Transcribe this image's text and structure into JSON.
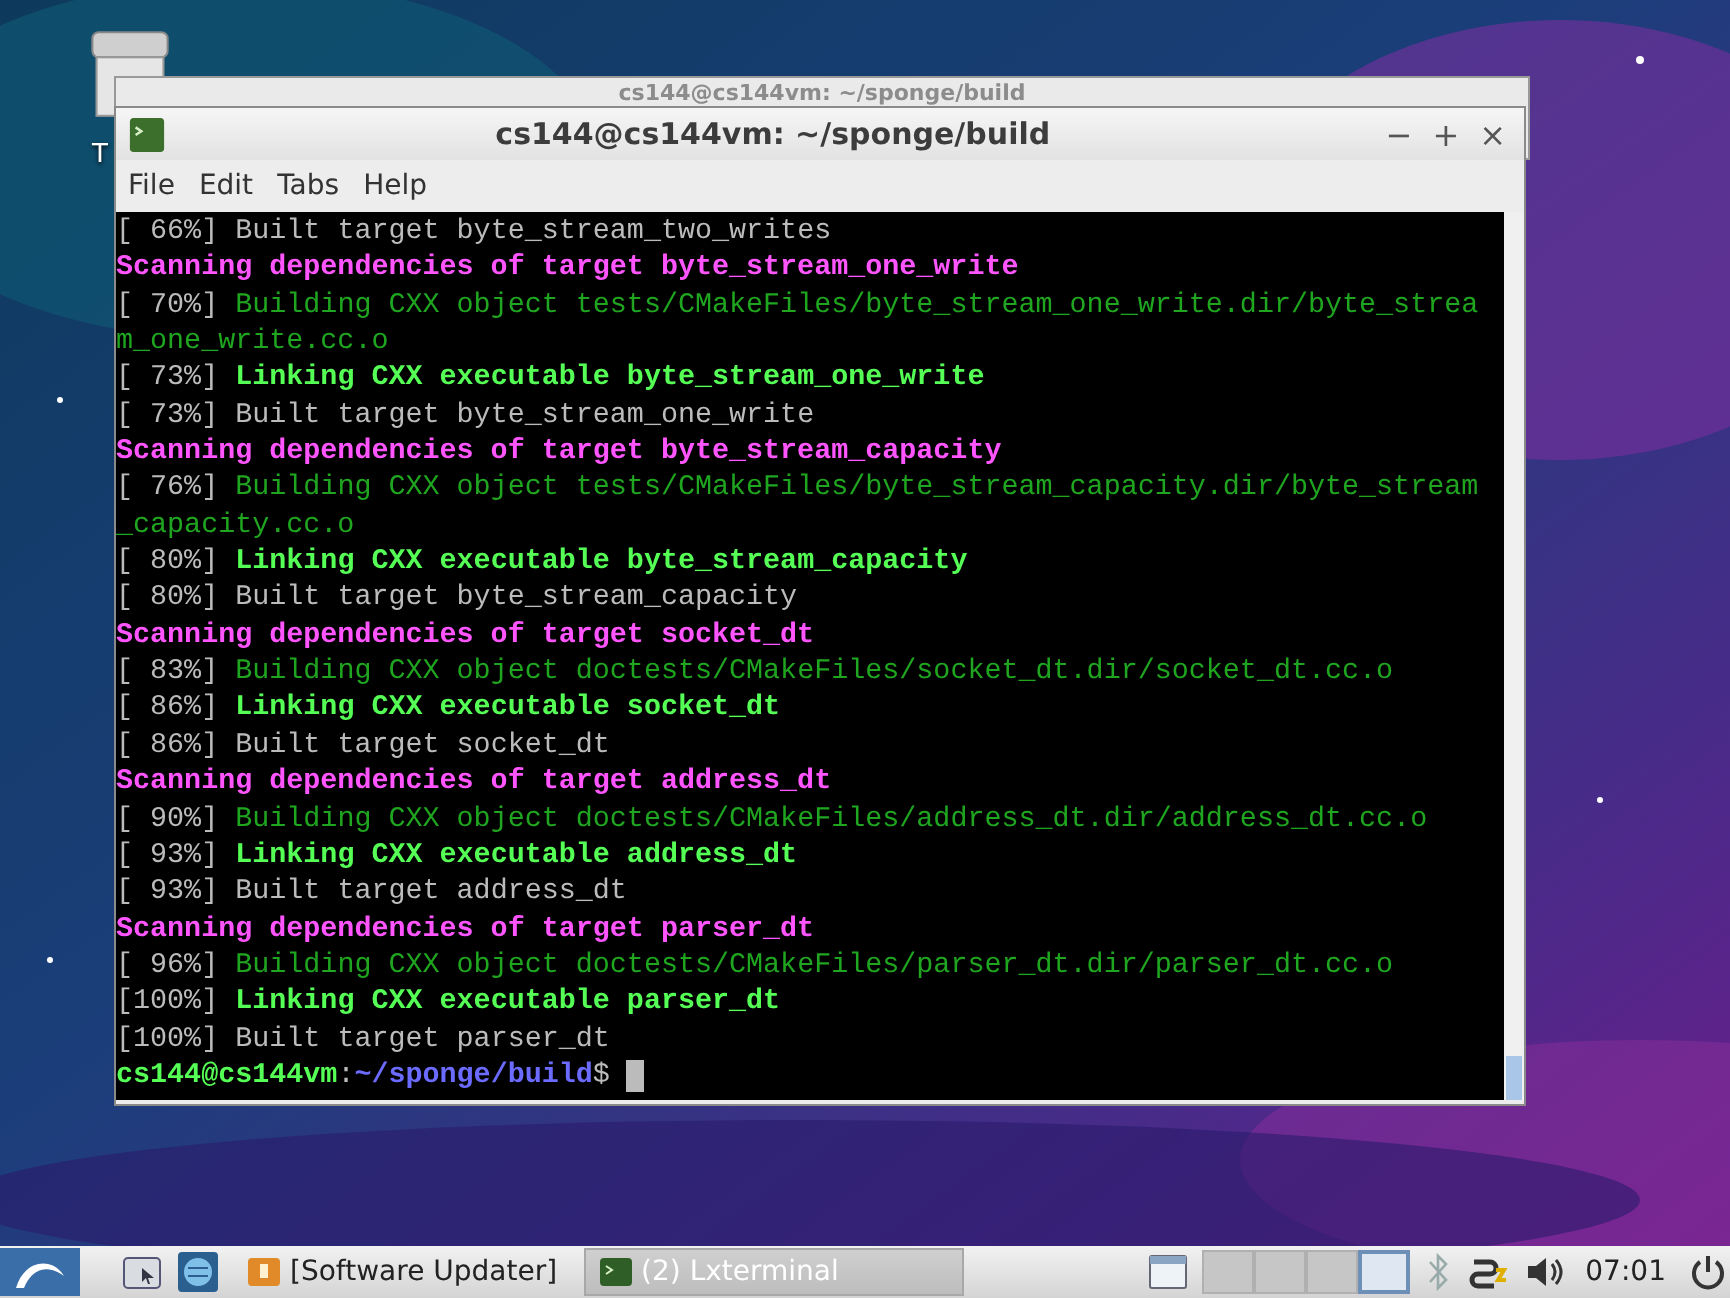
{
  "desktop": {
    "icon_label": "T"
  },
  "back_window": {
    "title": "cs144@cs144vm: ~/sponge/build"
  },
  "window": {
    "title": "cs144@cs144vm: ~/sponge/build",
    "controls": [
      "−",
      "+",
      "×"
    ]
  },
  "menu": [
    "File",
    "Edit",
    "Tabs",
    "Help"
  ],
  "terminal": {
    "lines": [
      {
        "kind": "built",
        "progress": "[ 66%]",
        "text": "Built target byte_stream_two_writes"
      },
      {
        "kind": "scan",
        "text": "Scanning dependencies of target byte_stream_one_write"
      },
      {
        "kind": "build",
        "progress": "[ 70%]",
        "text": "Building CXX object tests/CMakeFiles/byte_stream_one_write.dir/byte_strea"
      },
      {
        "kind": "build",
        "text": "m_one_write.cc.o"
      },
      {
        "kind": "link",
        "progress": "[ 73%]",
        "text": "Linking CXX executable byte_stream_one_write"
      },
      {
        "kind": "built",
        "progress": "[ 73%]",
        "text": "Built target byte_stream_one_write"
      },
      {
        "kind": "scan",
        "text": "Scanning dependencies of target byte_stream_capacity"
      },
      {
        "kind": "build",
        "progress": "[ 76%]",
        "text": "Building CXX object tests/CMakeFiles/byte_stream_capacity.dir/byte_stream"
      },
      {
        "kind": "build",
        "text": "_capacity.cc.o"
      },
      {
        "kind": "link",
        "progress": "[ 80%]",
        "text": "Linking CXX executable byte_stream_capacity"
      },
      {
        "kind": "built",
        "progress": "[ 80%]",
        "text": "Built target byte_stream_capacity"
      },
      {
        "kind": "scan",
        "text": "Scanning dependencies of target socket_dt"
      },
      {
        "kind": "build",
        "progress": "[ 83%]",
        "text": "Building CXX object doctests/CMakeFiles/socket_dt.dir/socket_dt.cc.o"
      },
      {
        "kind": "link",
        "progress": "[ 86%]",
        "text": "Linking CXX executable socket_dt"
      },
      {
        "kind": "built",
        "progress": "[ 86%]",
        "text": "Built target socket_dt"
      },
      {
        "kind": "scan",
        "text": "Scanning dependencies of target address_dt"
      },
      {
        "kind": "build",
        "progress": "[ 90%]",
        "text": "Building CXX object doctests/CMakeFiles/address_dt.dir/address_dt.cc.o"
      },
      {
        "kind": "link",
        "progress": "[ 93%]",
        "text": "Linking CXX executable address_dt"
      },
      {
        "kind": "built",
        "progress": "[ 93%]",
        "text": "Built target address_dt"
      },
      {
        "kind": "scan",
        "text": "Scanning dependencies of target parser_dt"
      },
      {
        "kind": "build",
        "progress": "[ 96%]",
        "text": "Building CXX object doctests/CMakeFiles/parser_dt.dir/parser_dt.cc.o"
      },
      {
        "kind": "link",
        "progress": "[100%]",
        "text": "Linking CXX executable parser_dt"
      },
      {
        "kind": "built",
        "progress": "[100%]",
        "text": "Built target parser_dt"
      }
    ],
    "prompt": {
      "user": "cs144@cs144vm",
      "separator": ":",
      "path": "~/sponge/build",
      "sign": "$"
    }
  },
  "taskbar": {
    "tasks": [
      {
        "label": "[Software Updater]",
        "kind": "updater",
        "selected": false
      },
      {
        "label": "(2) Lxterminal",
        "kind": "terminal",
        "selected": true
      }
    ],
    "workspaces": [
      {
        "selected": false
      },
      {
        "selected": false
      },
      {
        "selected": false
      },
      {
        "selected": true
      }
    ],
    "clock": "07:01"
  }
}
